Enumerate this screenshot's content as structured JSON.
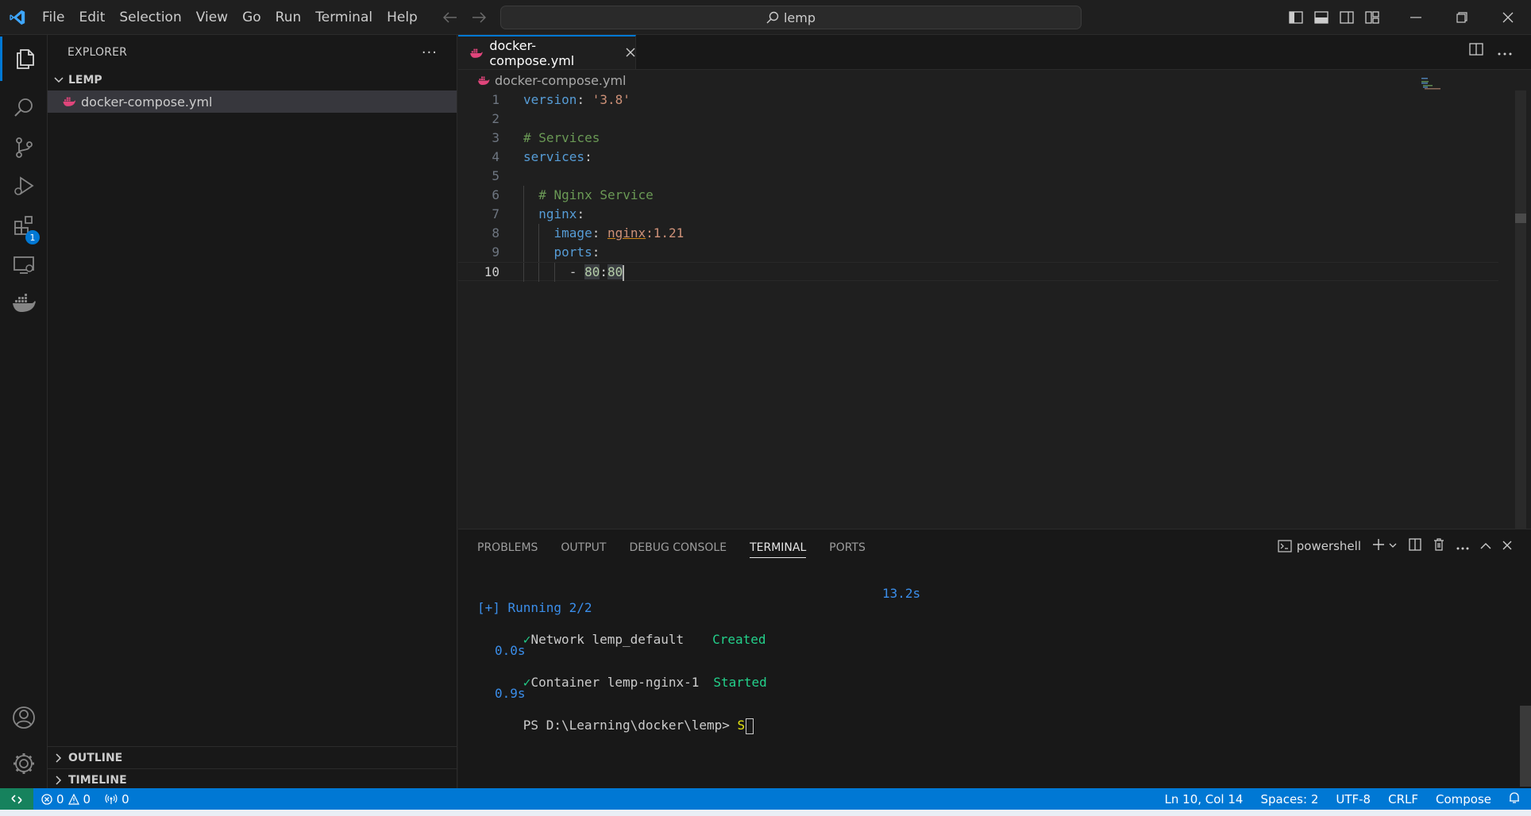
{
  "menu": [
    "File",
    "Edit",
    "Selection",
    "View",
    "Go",
    "Run",
    "Terminal",
    "Help"
  ],
  "command_center": {
    "text": "lemp"
  },
  "activity_bar": {
    "extensions_badge": "1"
  },
  "sidebar": {
    "title": "EXPLORER",
    "more": "···",
    "folder": "LEMP",
    "file": "docker-compose.yml",
    "outline": "OUTLINE",
    "timeline": "TIMELINE"
  },
  "editor": {
    "tab": "docker-compose.yml",
    "breadcrumb": "docker-compose.yml",
    "lines": [
      {
        "n": "1",
        "parts": [
          [
            "k",
            "version"
          ],
          [
            "p",
            ": "
          ],
          [
            "s",
            "'3.8'"
          ]
        ]
      },
      {
        "n": "2",
        "parts": []
      },
      {
        "n": "3",
        "parts": [
          [
            "c",
            "# Services"
          ]
        ]
      },
      {
        "n": "4",
        "parts": [
          [
            "k",
            "services"
          ],
          [
            "p",
            ":"
          ]
        ]
      },
      {
        "n": "5",
        "parts": []
      },
      {
        "n": "6",
        "parts": [
          [
            "p",
            "  "
          ],
          [
            "c",
            "# Nginx Service"
          ]
        ]
      },
      {
        "n": "7",
        "parts": [
          [
            "p",
            "  "
          ],
          [
            "k",
            "nginx"
          ],
          [
            "p",
            ":"
          ]
        ]
      },
      {
        "n": "8",
        "parts": [
          [
            "p",
            "    "
          ],
          [
            "k",
            "image"
          ],
          [
            "p",
            ": "
          ],
          [
            "sq",
            "nginx"
          ],
          [
            "s",
            ":1.21"
          ]
        ]
      },
      {
        "n": "9",
        "parts": [
          [
            "p",
            "    "
          ],
          [
            "k",
            "ports"
          ],
          [
            "p",
            ":"
          ]
        ]
      },
      {
        "n": "10",
        "parts": [
          [
            "p",
            "      - "
          ],
          [
            "hn",
            "80"
          ],
          [
            "p",
            ":"
          ],
          [
            "hn",
            "80"
          ]
        ]
      }
    ]
  },
  "panel": {
    "tabs": [
      "PROBLEMS",
      "OUTPUT",
      "DEBUG CONSOLE",
      "TERMINAL",
      "PORTS"
    ],
    "shell": "powershell",
    "terminal": {
      "time_total": "13.2s",
      "running": "[+] Running 2/2",
      "check": "✓",
      "network": "Network lemp_default",
      "network_status": "Created",
      "network_time": "0.0s",
      "container": "Container lemp-nginx-1",
      "container_status": "Started",
      "container_time": "0.9s",
      "prompt": "PS D:\\Learning\\docker\\lemp> ",
      "input": "S"
    }
  },
  "status": {
    "errors": "0",
    "warnings": "0",
    "ports": "0",
    "position": "Ln 10, Col 14",
    "spaces": "Spaces: 2",
    "encoding": "UTF-8",
    "eol": "CRLF",
    "language": "Compose"
  },
  "colors": {
    "accent": "#0078d4",
    "remote": "#16825d",
    "docker": "#e0457b"
  }
}
